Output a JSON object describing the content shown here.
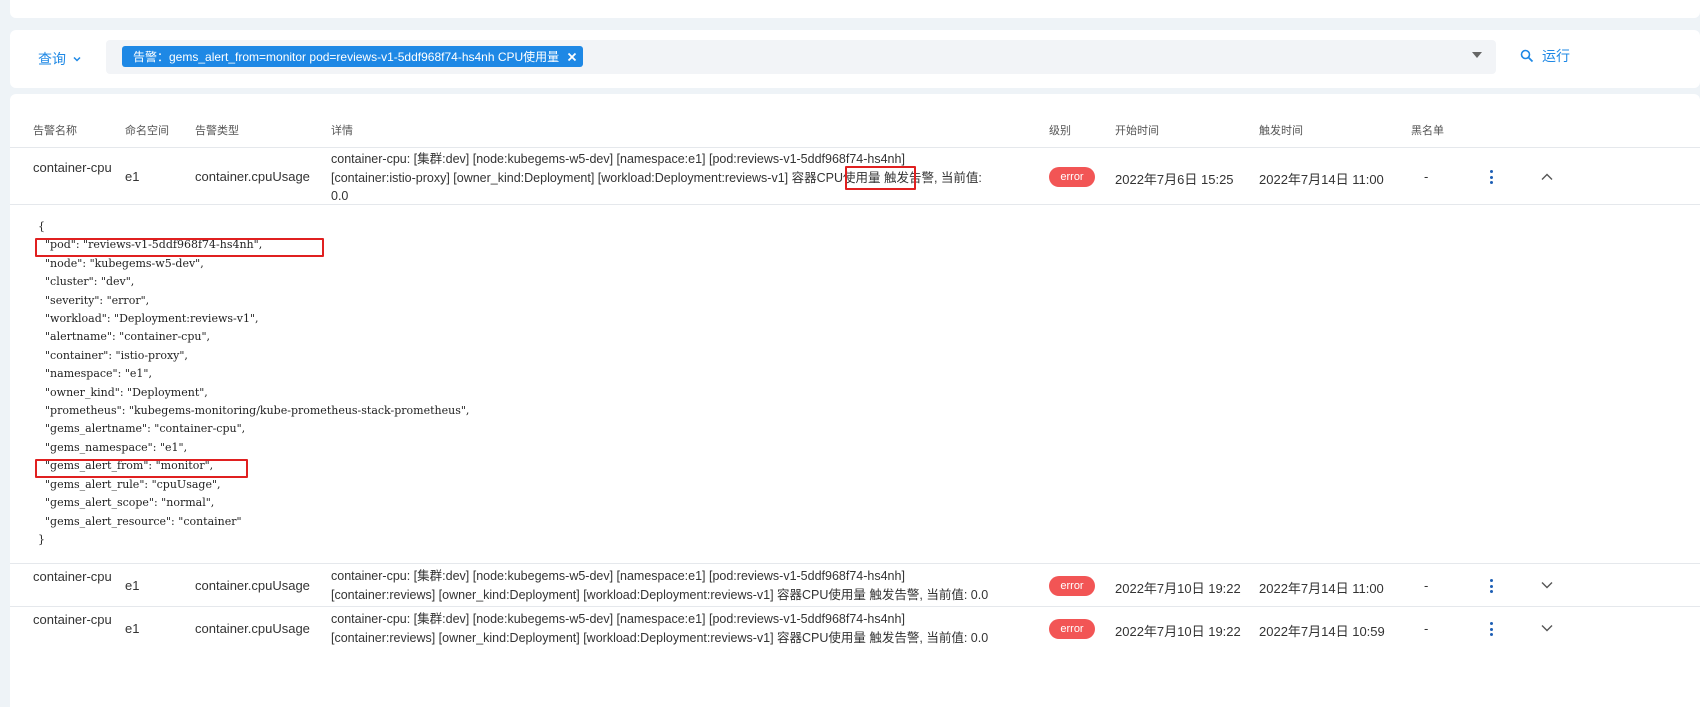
{
  "query": {
    "label": "查询"
  },
  "filter": {
    "chip_text": "告警：gems_alert_from=monitor pod=reviews-v1-5ddf968f74-hs4nh CPU使用量"
  },
  "run": {
    "label": "运行"
  },
  "table": {
    "columns": [
      "告警名称",
      "命名空间",
      "告警类型",
      "详情",
      "级别",
      "开始时间",
      "触发时间",
      "黑名单"
    ],
    "rows": [
      {
        "name": "container-cpu",
        "namespace": "e1",
        "type": "container.cpuUsage",
        "detail_line1": "container-cpu: [集群:dev] [node:kubegems-w5-dev] [namespace:e1] [pod:reviews-v1-5ddf968f74-hs4nh]",
        "detail_line2": "[container:istio-proxy] [owner_kind:Deployment] [workload:Deployment:reviews-v1] 容器CPU使用量 触发告警, 当前值:",
        "detail_line3": "0.0",
        "level": "error",
        "start": "2022年7月6日 15:25",
        "trigger": "2022年7月14日 11:00",
        "blacklist": "-"
      },
      {
        "name": "container-cpu",
        "namespace": "e1",
        "type": "container.cpuUsage",
        "detail_line1": "container-cpu: [集群:dev] [node:kubegems-w5-dev] [namespace:e1] [pod:reviews-v1-5ddf968f74-hs4nh]",
        "detail_line2": "[container:reviews] [owner_kind:Deployment] [workload:Deployment:reviews-v1] 容器CPU使用量 触发告警, 当前值: 0.0",
        "level": "error",
        "start": "2022年7月10日 19:22",
        "trigger": "2022年7月14日 11:00",
        "blacklist": "-"
      },
      {
        "name": "container-cpu",
        "namespace": "e1",
        "type": "container.cpuUsage",
        "detail_line1": "container-cpu: [集群:dev] [node:kubegems-w5-dev] [namespace:e1] [pod:reviews-v1-5ddf968f74-hs4nh]",
        "detail_line2": "[container:reviews] [owner_kind:Deployment] [workload:Deployment:reviews-v1] 容器CPU使用量 触发告警, 当前值: 0.0",
        "level": "error",
        "start": "2022年7月10日 19:22",
        "trigger": "2022年7月14日 10:59",
        "blacklist": "-"
      }
    ]
  },
  "labels_json": {
    "open": "{",
    "lines": [
      "  \"pod\": \"reviews-v1-5ddf968f74-hs4nh\",",
      "  \"node\": \"kubegems-w5-dev\",",
      "  \"cluster\": \"dev\",",
      "  \"severity\": \"error\",",
      "  \"workload\": \"Deployment:reviews-v1\",",
      "  \"alertname\": \"container-cpu\",",
      "  \"container\": \"istio-proxy\",",
      "  \"namespace\": \"e1\",",
      "  \"owner_kind\": \"Deployment\",",
      "  \"prometheus\": \"kubegems-monitoring/kube-prometheus-stack-prometheus\",",
      "  \"gems_alertname\": \"container-cpu\",",
      "  \"gems_namespace\": \"e1\",",
      "  \"gems_alert_from\": \"monitor\",",
      "  \"gems_alert_rule\": \"cpuUsage\",",
      "  \"gems_alert_scope\": \"normal\",",
      "  \"gems_alert_resource\": \"container\""
    ],
    "close": "}"
  },
  "colors": {
    "accent": "#1e88e5",
    "error_badge": "#f25555",
    "highlight_box": "#e02020"
  }
}
